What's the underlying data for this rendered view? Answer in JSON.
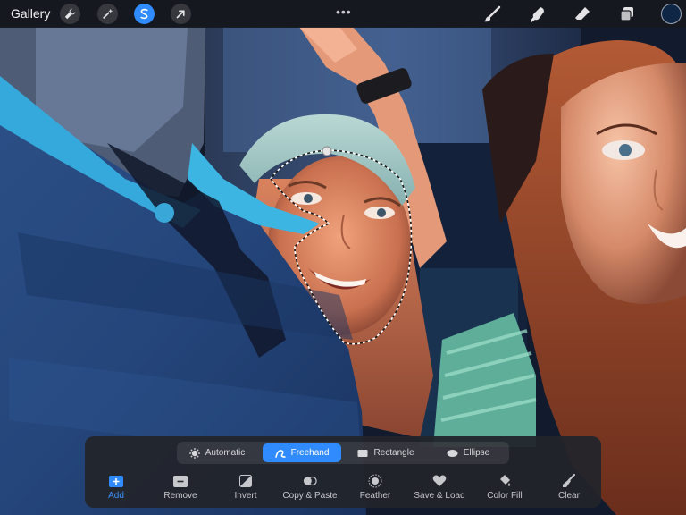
{
  "topbar": {
    "gallery_label": "Gallery",
    "more_label": "•••",
    "left_tools": [
      "wrench-icon",
      "magic-wand-icon",
      "selection-icon",
      "transform-arrow-icon"
    ],
    "active_tool": "selection-icon",
    "right_tools": [
      "brush-icon",
      "smudge-icon",
      "eraser-icon",
      "layers-icon"
    ],
    "color_swatch": "#0f2745"
  },
  "selection_panel": {
    "modes": [
      {
        "label": "Automatic",
        "icon": "automatic-icon",
        "active": false
      },
      {
        "label": "Freehand",
        "icon": "freehand-icon",
        "active": true
      },
      {
        "label": "Rectangle",
        "icon": "rectangle-icon",
        "active": false
      },
      {
        "label": "Ellipse",
        "icon": "ellipse-icon",
        "active": false
      }
    ],
    "actions": [
      {
        "label": "Add",
        "icon": "add-icon",
        "active": true
      },
      {
        "label": "Remove",
        "icon": "remove-icon",
        "active": false
      },
      {
        "label": "Invert",
        "icon": "invert-icon",
        "active": false
      },
      {
        "label": "Copy & Paste",
        "icon": "copy-paste-icon",
        "active": false
      },
      {
        "label": "Feather",
        "icon": "feather-icon",
        "active": false
      },
      {
        "label": "Save & Load",
        "icon": "save-load-icon",
        "active": false
      },
      {
        "label": "Color Fill",
        "icon": "color-fill-icon",
        "active": false
      },
      {
        "label": "Clear",
        "icon": "clear-icon",
        "active": false
      }
    ]
  },
  "colors": {
    "accent": "#2f8bff",
    "toolbar_bg": "#16181e",
    "panel_bg": "#22242a"
  }
}
